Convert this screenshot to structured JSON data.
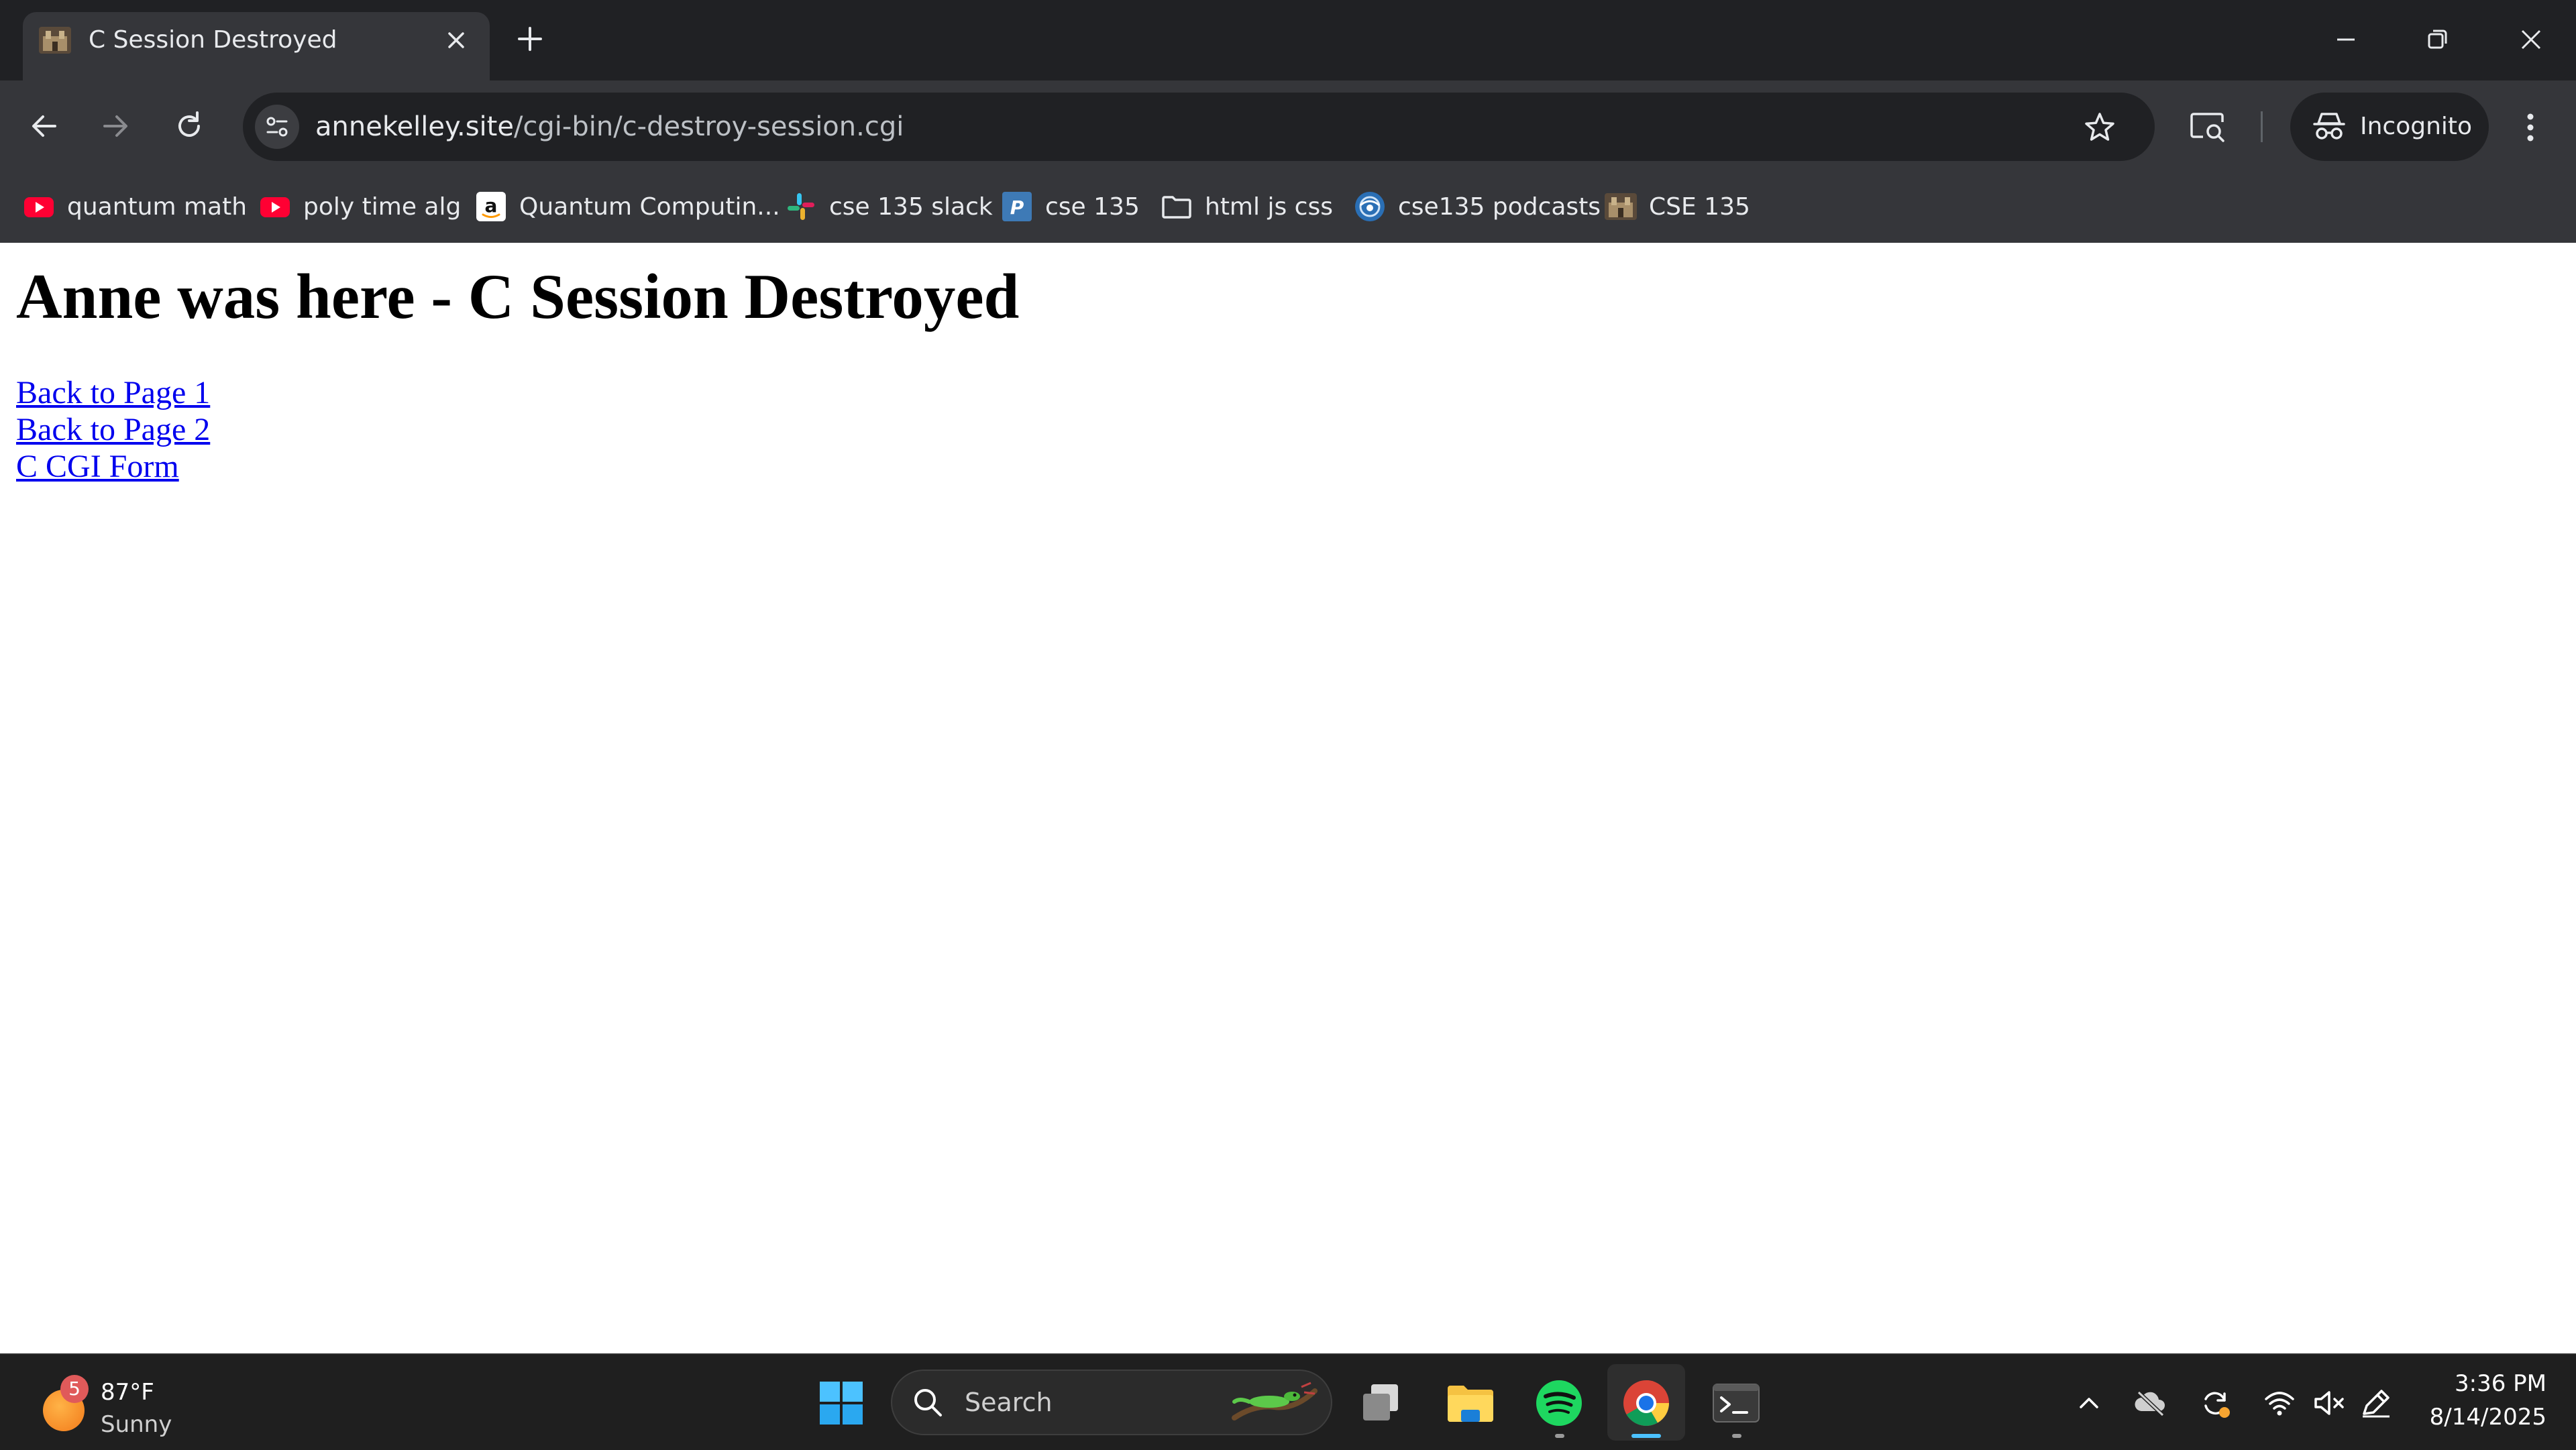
{
  "browser": {
    "tab": {
      "title": "C Session Destroyed",
      "favicon": "castle-favicon"
    },
    "url": {
      "host": "annekelley.site",
      "path": "/cgi-bin/c-destroy-session.cgi"
    },
    "profile_label": "Incognito",
    "icons": [
      "back-icon",
      "forward-icon",
      "reload-icon",
      "site-info-icon",
      "bookmark-star-icon",
      "lens-icon",
      "incognito-icon",
      "menu-icon",
      "new-tab-icon",
      "minimize-icon",
      "restore-icon",
      "close-window-icon"
    ]
  },
  "bookmarks": [
    {
      "label": "quantum math",
      "icon": "youtube-icon"
    },
    {
      "label": "poly time alg",
      "icon": "youtube-icon"
    },
    {
      "label": "Quantum Computin...",
      "icon": "amazon-icon"
    },
    {
      "label": "cse 135 slack",
      "icon": "slack-icon"
    },
    {
      "label": "cse 135",
      "icon": "piazza-icon"
    },
    {
      "label": "html js css",
      "icon": "folder-icon"
    },
    {
      "label": "cse135 podcasts",
      "icon": "podcast-icon"
    },
    {
      "label": "CSE 135",
      "icon": "castle-icon"
    }
  ],
  "page": {
    "heading": "Anne was here - C Session Destroyed",
    "links": [
      "Back to Page 1",
      "Back to Page 2",
      "C CGI Form"
    ]
  },
  "taskbar": {
    "weather": {
      "temp": "87°F",
      "condition": "Sunny",
      "badge": "5"
    },
    "search_label": "Search",
    "apps": [
      "start-icon",
      "task-view-icon",
      "file-explorer-icon",
      "spotify-icon",
      "chrome-icon",
      "terminal-icon"
    ],
    "tray": [
      "chevron-up-icon",
      "onedrive-offline-icon",
      "sync-icon",
      "wifi-icon",
      "volume-muted-icon",
      "pen-icon"
    ],
    "time": "3:36 PM",
    "date": "8/14/2025"
  },
  "colors": {
    "chrome_dark": "#202124",
    "chrome_toolbar": "#35363a",
    "link": "#0000ee",
    "taskbar": "#1f1f1f",
    "active_indicator": "#4cc2ff"
  }
}
